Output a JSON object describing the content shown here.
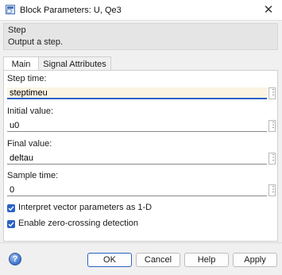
{
  "window": {
    "title": "Block Parameters: U, Qe3",
    "close_glyph": "✕"
  },
  "header": {
    "block_type": "Step",
    "description": "Output a step."
  },
  "tabs": [
    {
      "label": "Main",
      "active": true
    },
    {
      "label": "Signal Attributes",
      "active": false
    }
  ],
  "params": {
    "step_time": {
      "label": "Step time:",
      "value": "steptimeu"
    },
    "initial_value": {
      "label": "Initial value:",
      "value": "u0"
    },
    "final_value": {
      "label": "Final value:",
      "value": "deltau"
    },
    "sample_time": {
      "label": "Sample time:",
      "value": "0"
    },
    "more_glyph": "⋮"
  },
  "options": {
    "interpret_vector": {
      "label": "Interpret vector parameters as 1-D",
      "checked": true
    },
    "zero_crossing": {
      "label": "Enable zero-crossing detection",
      "checked": true
    }
  },
  "buttons": {
    "help_icon_glyph": "?",
    "ok": "OK",
    "cancel": "Cancel",
    "help": "Help",
    "apply": "Apply"
  },
  "colors": {
    "accent": "#2b62c9",
    "active_field_bg": "#fbf4e3"
  }
}
